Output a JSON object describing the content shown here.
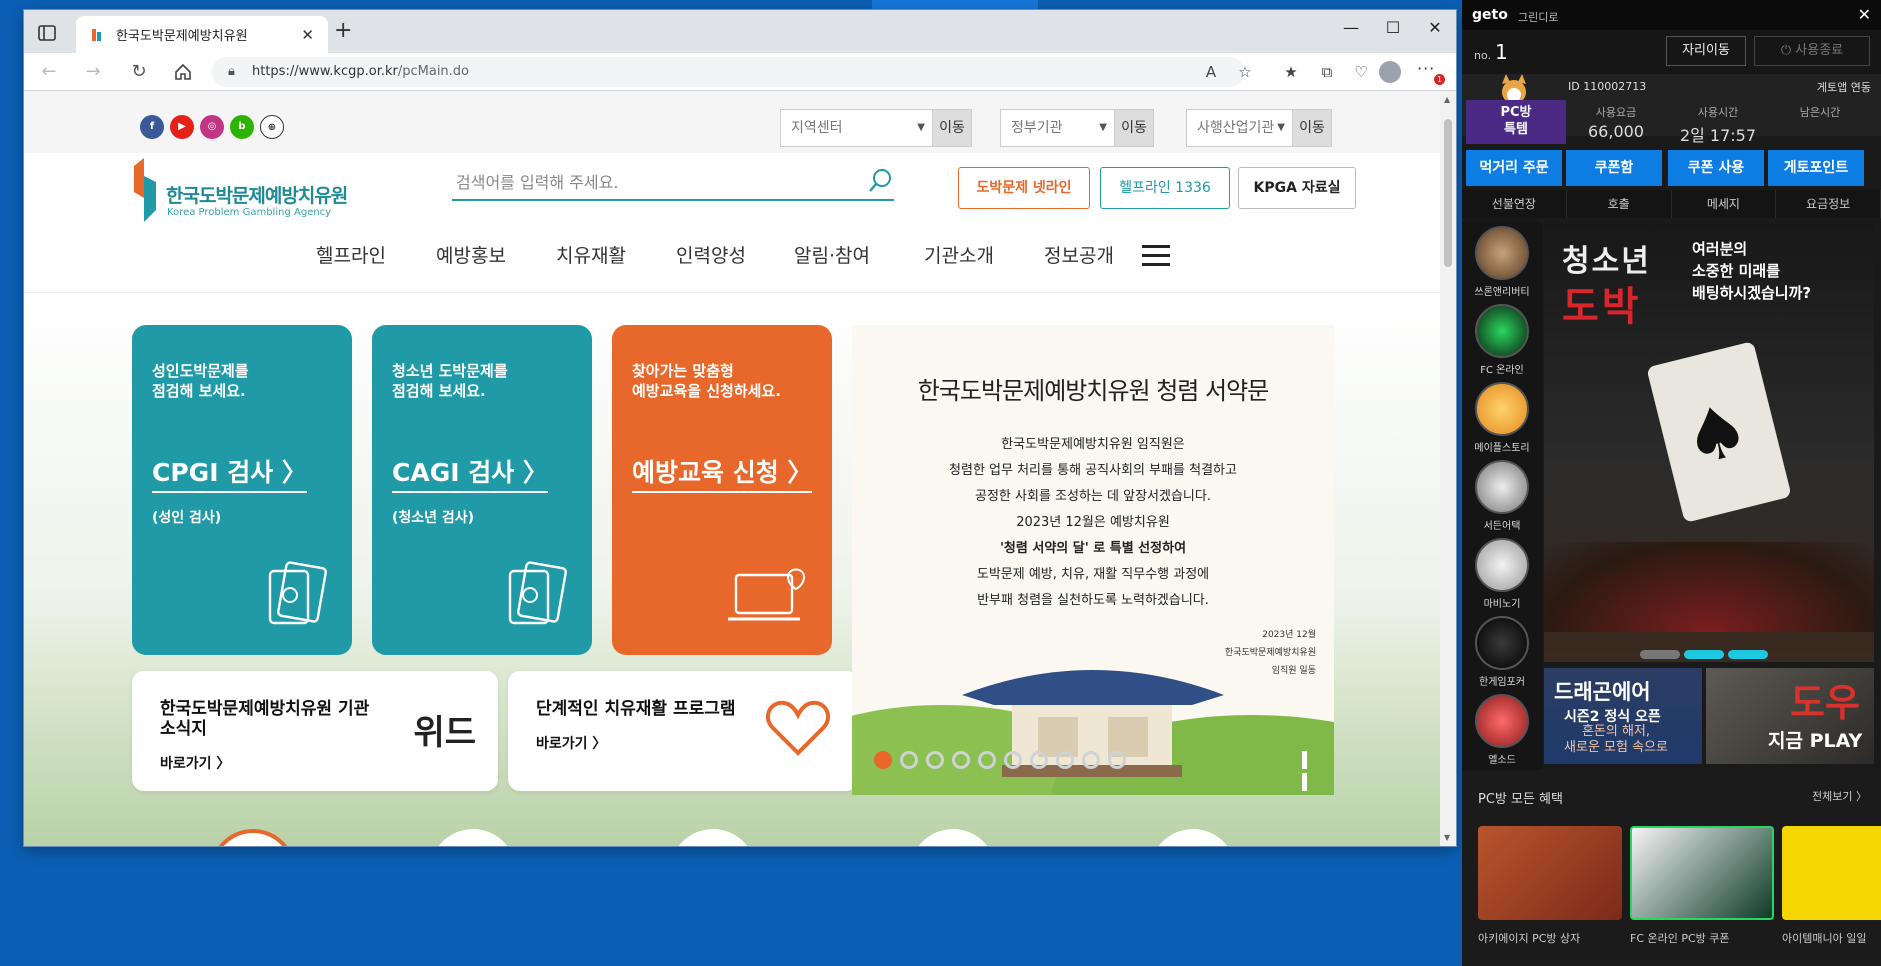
{
  "browser": {
    "tab_title": "한국도박문제예방치유원",
    "url_host": "https://www.kcgp.or.kr",
    "url_path": "/pcMain.do"
  },
  "site": {
    "selects": [
      {
        "placeholder": "지역센터",
        "go": "이동"
      },
      {
        "placeholder": "정부기관",
        "go": "이동"
      },
      {
        "placeholder": "사행산업기관",
        "go": "이동"
      }
    ],
    "logo_kr": "한국도박문제예방치유원",
    "logo_en": "Korea Problem Gambling Agency",
    "search_placeholder": "검색어를 입력해 주세요.",
    "header_buttons": [
      "도박문제 넷라인",
      "헬프라인 1336",
      "KPGA 자료실"
    ],
    "nav": [
      "헬프라인",
      "예방홍보",
      "치유재활",
      "인력양성",
      "알림·참여",
      "기관소개",
      "정보공개"
    ],
    "cards": [
      {
        "sub": "성인도박문제를\n점검해 보세요.",
        "title": "CPGI 검사 〉",
        "note": "(성인 검사)"
      },
      {
        "sub": "청소년 도박문제를\n점검해 보세요.",
        "title": "CAGI 검사 〉",
        "note": "(청소년 검사)"
      },
      {
        "sub": "찾아가는 맞춤형\n예방교육을 신청하세요.",
        "title": "예방교육 신청 〉",
        "note": ""
      }
    ],
    "wide_cards": [
      {
        "title": "한국도박문제예방치유원 기관\n소식지",
        "link": "바로가기 〉",
        "logo": "위드"
      },
      {
        "title": "단계적인 치유재활 프로그램",
        "link": "바로가기 〉"
      }
    ],
    "banner": {
      "title": "한국도박문제예방치유원 청렴 서약문",
      "lines": [
        "한국도박문제예방치유원 임직원은",
        "청렴한 업무 처리를 통해 공직사회의 부패를 척결하고",
        "공정한 사회를 조성하는 데 앞장서겠습니다.",
        "2023년 12월은 예방치유원",
        "'청렴 서약의 달' 로 특별 선정하여",
        "도박문제 예방, 치유, 재활 직무수행 과정에",
        "반부패 청렴을 실천하도록 노력하겠습니다."
      ],
      "sign": [
        "2023년 12월",
        "한국도박문제예방치유원",
        "임직원 일동"
      ]
    }
  },
  "geto": {
    "logo": "geto",
    "subtitle": "그린디로",
    "no_label": "no.",
    "no_value": "1",
    "move_btn": "자리이동",
    "end_btn": "⏻ 사용종료",
    "id_label": "ID 110002713",
    "app_link": "게토앱 연동",
    "pcbang": "PC방\n특템",
    "stats": [
      {
        "k": "사용요금",
        "v": "66,000"
      },
      {
        "k": "사용시간",
        "v": "2일 17:57"
      },
      {
        "k": "남은시간",
        "v": ""
      }
    ],
    "blue_buttons": [
      "먹거리 주문",
      "쿠폰함",
      "쿠폰 사용",
      "게토포인트"
    ],
    "tabs": [
      "선불연장",
      "호출",
      "메세지",
      "요금정보"
    ],
    "games": [
      "쓰론앤리버티",
      "FC 온라인",
      "메이플스토리",
      "서든어택",
      "마비노기",
      "한게임포커",
      "엘소드"
    ],
    "ad": {
      "t1": "청소년",
      "t2": "도박",
      "t3": "여러분의\n소중한 미래를\n배팅하시겠습니까?"
    },
    "banner_left": {
      "l1": "드래곤에어",
      "l2": "시즌2 정식 오픈",
      "l3": "혼돈의 해저,\n새로운 모험 속으로"
    },
    "banner_right": {
      "l1": "도우",
      "l2": "지금 PLAY"
    },
    "benefits_title": "PC방 모든 혜택",
    "benefits_all": "전체보기 〉",
    "benefits": [
      "아키에이지 PC방 상자",
      "FC 온라인 PC방 쿠폰",
      "아이템매니아 일일"
    ]
  }
}
